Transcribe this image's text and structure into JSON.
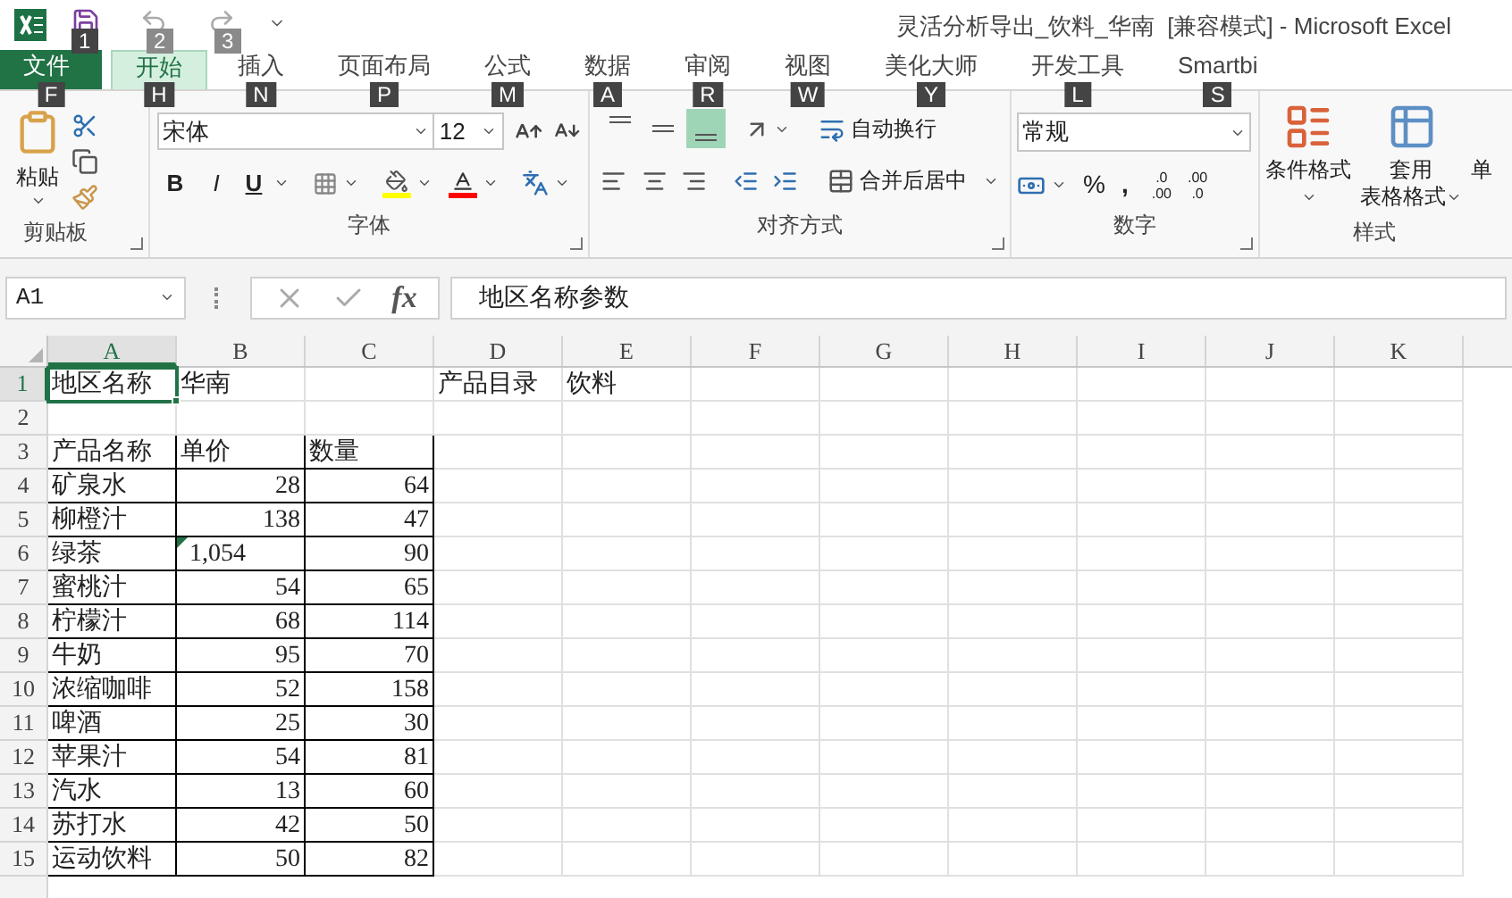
{
  "window": {
    "title": "灵活分析导出_饮料_华南  [兼容模式] - Microsoft Excel"
  },
  "quick_access": {
    "key_tips": [
      "1",
      "2",
      "3"
    ]
  },
  "ribbon_tabs": [
    {
      "label": "文件",
      "key_tip": "F",
      "kind": "file",
      "selected": false
    },
    {
      "label": "开始",
      "key_tip": "H",
      "kind": "tab",
      "selected": true
    },
    {
      "label": "插入",
      "key_tip": "N",
      "kind": "tab",
      "selected": false
    },
    {
      "label": "页面布局",
      "key_tip": "P",
      "kind": "tab",
      "selected": false
    },
    {
      "label": "公式",
      "key_tip": "M",
      "kind": "tab",
      "selected": false
    },
    {
      "label": "数据",
      "key_tip": "A",
      "kind": "tab",
      "selected": false
    },
    {
      "label": "审阅",
      "key_tip": "R",
      "kind": "tab",
      "selected": false
    },
    {
      "label": "视图",
      "key_tip": "W",
      "kind": "tab",
      "selected": false
    },
    {
      "label": "美化大师",
      "key_tip": "Y",
      "kind": "tab",
      "selected": false
    },
    {
      "label": "开发工具",
      "key_tip": "L",
      "kind": "tab",
      "selected": false
    },
    {
      "label": "Smartbi",
      "key_tip": "S",
      "kind": "tab",
      "selected": false
    }
  ],
  "clipboard": {
    "paste": "粘贴",
    "label": "剪贴板"
  },
  "font": {
    "name": "宋体",
    "size": "12",
    "bold": "B",
    "italic": "I",
    "underline": "U",
    "label": "字体"
  },
  "alignment": {
    "bottom_align_on": true,
    "wrap_text": "自动换行",
    "merge_center": "合并后居中",
    "label": "对齐方式"
  },
  "number": {
    "format": "常规",
    "percent": "%",
    "comma": ",",
    "increase_decimal": [
      ".0",
      ".00"
    ],
    "decrease_decimal": [
      ".00",
      ".0"
    ],
    "label": "数字"
  },
  "styles": {
    "conditional": "条件格式",
    "table_format": [
      "套用",
      "表格格式"
    ],
    "cut_off": "单",
    "label": "样式"
  },
  "formula_bar": {
    "name_box": "A1",
    "fx": "fx",
    "formula": "地区名称参数"
  },
  "grid": {
    "columns": [
      {
        "label": "A",
        "selected": true
      },
      {
        "label": "B",
        "selected": false
      },
      {
        "label": "C",
        "selected": false
      },
      {
        "label": "D",
        "selected": false
      },
      {
        "label": "E",
        "selected": false
      },
      {
        "label": "F",
        "selected": false
      },
      {
        "label": "G",
        "selected": false
      },
      {
        "label": "H",
        "selected": false
      },
      {
        "label": "I",
        "selected": false
      },
      {
        "label": "J",
        "selected": false
      },
      {
        "label": "K",
        "selected": false
      }
    ],
    "rows": [
      {
        "label": "1",
        "selected": true,
        "kind": "plain",
        "cells": [
          {
            "text": "地区名称"
          },
          {
            "text": "华南"
          },
          {},
          {
            "text": "产品目录"
          },
          {
            "text": "饮料"
          }
        ]
      },
      {
        "label": "2",
        "selected": false,
        "kind": "plain",
        "cells": []
      },
      {
        "label": "3",
        "selected": false,
        "kind": "table",
        "cells": [
          {
            "text": "产品名称"
          },
          {
            "text": "单价"
          },
          {
            "text": "数量"
          }
        ]
      },
      {
        "label": "4",
        "selected": false,
        "kind": "table",
        "cells": [
          {
            "text": "矿泉水"
          },
          {
            "text": "28",
            "kind": "number"
          },
          {
            "text": "64",
            "kind": "number"
          }
        ]
      },
      {
        "label": "5",
        "selected": false,
        "kind": "table",
        "cells": [
          {
            "text": "柳橙汁"
          },
          {
            "text": "138",
            "kind": "number"
          },
          {
            "text": "47",
            "kind": "number"
          }
        ]
      },
      {
        "label": "6",
        "selected": false,
        "kind": "table",
        "cells": [
          {
            "text": "绿茶"
          },
          {
            "text": "1,054",
            "error_flag": true
          },
          {
            "text": "90",
            "kind": "number"
          }
        ]
      },
      {
        "label": "7",
        "selected": false,
        "kind": "table",
        "cells": [
          {
            "text": "蜜桃汁"
          },
          {
            "text": "54",
            "kind": "number"
          },
          {
            "text": "65",
            "kind": "number"
          }
        ]
      },
      {
        "label": "8",
        "selected": false,
        "kind": "table",
        "cells": [
          {
            "text": "柠檬汁"
          },
          {
            "text": "68",
            "kind": "number"
          },
          {
            "text": "114",
            "kind": "number"
          }
        ]
      },
      {
        "label": "9",
        "selected": false,
        "kind": "table",
        "cells": [
          {
            "text": "牛奶"
          },
          {
            "text": "95",
            "kind": "number"
          },
          {
            "text": "70",
            "kind": "number"
          }
        ]
      },
      {
        "label": "10",
        "selected": false,
        "kind": "table",
        "cells": [
          {
            "text": "浓缩咖啡"
          },
          {
            "text": "52",
            "kind": "number"
          },
          {
            "text": "158",
            "kind": "number"
          }
        ]
      },
      {
        "label": "11",
        "selected": false,
        "kind": "table",
        "cells": [
          {
            "text": "啤酒"
          },
          {
            "text": "25",
            "kind": "number"
          },
          {
            "text": "30",
            "kind": "number"
          }
        ]
      },
      {
        "label": "12",
        "selected": false,
        "kind": "table",
        "cells": [
          {
            "text": "苹果汁"
          },
          {
            "text": "54",
            "kind": "number"
          },
          {
            "text": "81",
            "kind": "number"
          }
        ]
      },
      {
        "label": "13",
        "selected": false,
        "kind": "table",
        "cells": [
          {
            "text": "汽水"
          },
          {
            "text": "13",
            "kind": "number"
          },
          {
            "text": "60",
            "kind": "number"
          }
        ]
      },
      {
        "label": "14",
        "selected": false,
        "kind": "table",
        "cells": [
          {
            "text": "苏打水"
          },
          {
            "text": "42",
            "kind": "number"
          },
          {
            "text": "50",
            "kind": "number"
          }
        ]
      },
      {
        "label": "15",
        "selected": false,
        "kind": "table",
        "cells": [
          {
            "text": "运动饮料"
          },
          {
            "text": "50",
            "kind": "number"
          },
          {
            "text": "82",
            "kind": "number"
          }
        ]
      }
    ]
  }
}
